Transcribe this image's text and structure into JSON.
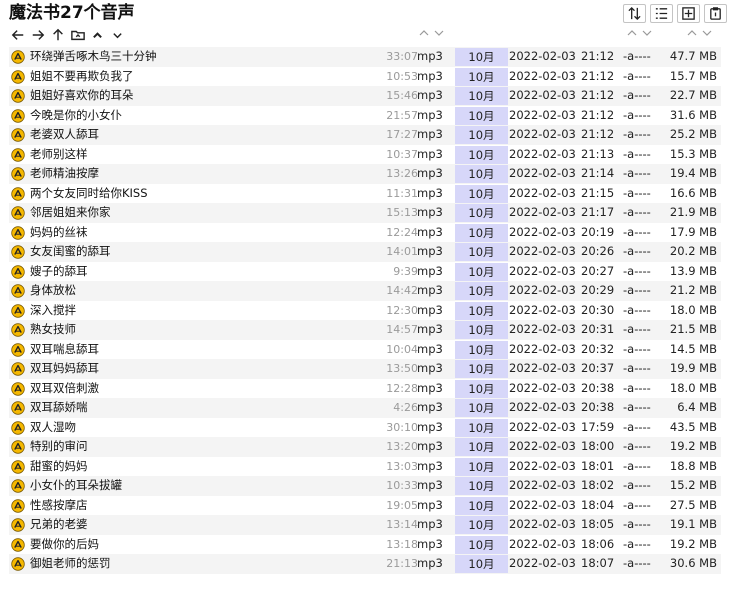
{
  "window": {
    "title": "魔法书27个音声"
  },
  "toolbar": {
    "icons": [
      "sort-icon",
      "checklist-icon",
      "add-box-icon",
      "paste-icon"
    ]
  },
  "nav": {
    "icons": [
      "back-arrow-icon",
      "forward-arrow-icon",
      "up-arrow-icon",
      "folder-up-icon",
      "collapse-up-icon",
      "expand-down-icon"
    ]
  },
  "columns": [
    "name",
    "duration",
    "ext",
    "month",
    "date",
    "time",
    "attributes",
    "size"
  ],
  "files": [
    {
      "name": "环绕弹舌啄木鸟三十分钟",
      "duration": "33:07",
      "ext": "mp3",
      "month": "10月",
      "date": "2022-02-03",
      "time": "21:12",
      "attr": "-a----",
      "size": "47.7 MB"
    },
    {
      "name": "姐姐不要再欺负我了",
      "duration": "10:53",
      "ext": "mp3",
      "month": "10月",
      "date": "2022-02-03",
      "time": "21:12",
      "attr": "-a----",
      "size": "15.7 MB"
    },
    {
      "name": "姐姐好喜欢你的耳朵",
      "duration": "15:46",
      "ext": "mp3",
      "month": "10月",
      "date": "2022-02-03",
      "time": "21:12",
      "attr": "-a----",
      "size": "22.7 MB"
    },
    {
      "name": "今晚是你的小女仆",
      "duration": "21:57",
      "ext": "mp3",
      "month": "10月",
      "date": "2022-02-03",
      "time": "21:12",
      "attr": "-a----",
      "size": "31.6 MB"
    },
    {
      "name": "老婆双人舔耳",
      "duration": "17:27",
      "ext": "mp3",
      "month": "10月",
      "date": "2022-02-03",
      "time": "21:12",
      "attr": "-a----",
      "size": "25.2 MB"
    },
    {
      "name": "老师别这样",
      "duration": "10:37",
      "ext": "mp3",
      "month": "10月",
      "date": "2022-02-03",
      "time": "21:13",
      "attr": "-a----",
      "size": "15.3 MB"
    },
    {
      "name": "老师精油按摩",
      "duration": "13:26",
      "ext": "mp3",
      "month": "10月",
      "date": "2022-02-03",
      "time": "21:14",
      "attr": "-a----",
      "size": "19.4 MB"
    },
    {
      "name": "两个女友同时给你KISS",
      "duration": "11:31",
      "ext": "mp3",
      "month": "10月",
      "date": "2022-02-03",
      "time": "21:15",
      "attr": "-a----",
      "size": "16.6 MB"
    },
    {
      "name": "邻居姐姐来你家",
      "duration": "15:13",
      "ext": "mp3",
      "month": "10月",
      "date": "2022-02-03",
      "time": "21:17",
      "attr": "-a----",
      "size": "21.9 MB"
    },
    {
      "name": "妈妈的丝袜",
      "duration": "12:24",
      "ext": "mp3",
      "month": "10月",
      "date": "2022-02-03",
      "time": "20:19",
      "attr": "-a----",
      "size": "17.9 MB"
    },
    {
      "name": "女友闺蜜的舔耳",
      "duration": "14:01",
      "ext": "mp3",
      "month": "10月",
      "date": "2022-02-03",
      "time": "20:26",
      "attr": "-a----",
      "size": "20.2 MB"
    },
    {
      "name": "嫂子的舔耳",
      "duration": "9:39",
      "ext": "mp3",
      "month": "10月",
      "date": "2022-02-03",
      "time": "20:27",
      "attr": "-a----",
      "size": "13.9 MB"
    },
    {
      "name": "身体放松",
      "duration": "14:42",
      "ext": "mp3",
      "month": "10月",
      "date": "2022-02-03",
      "time": "20:29",
      "attr": "-a----",
      "size": "21.2 MB"
    },
    {
      "name": "深入搅拌",
      "duration": "12:30",
      "ext": "mp3",
      "month": "10月",
      "date": "2022-02-03",
      "time": "20:30",
      "attr": "-a----",
      "size": "18.0 MB"
    },
    {
      "name": "熟女技师",
      "duration": "14:57",
      "ext": "mp3",
      "month": "10月",
      "date": "2022-02-03",
      "time": "20:31",
      "attr": "-a----",
      "size": "21.5 MB"
    },
    {
      "name": "双耳喘息舔耳",
      "duration": "10:04",
      "ext": "mp3",
      "month": "10月",
      "date": "2022-02-03",
      "time": "20:32",
      "attr": "-a----",
      "size": "14.5 MB"
    },
    {
      "name": "双耳妈妈舔耳",
      "duration": "13:50",
      "ext": "mp3",
      "month": "10月",
      "date": "2022-02-03",
      "time": "20:37",
      "attr": "-a----",
      "size": "19.9 MB"
    },
    {
      "name": "双耳双倍刺激",
      "duration": "12:28",
      "ext": "mp3",
      "month": "10月",
      "date": "2022-02-03",
      "time": "20:38",
      "attr": "-a----",
      "size": "18.0 MB"
    },
    {
      "name": "双耳舔娇喘",
      "duration": "4:26",
      "ext": "mp3",
      "month": "10月",
      "date": "2022-02-03",
      "time": "20:38",
      "attr": "-a----",
      "size": "6.4 MB"
    },
    {
      "name": "双人湿吻",
      "duration": "30:10",
      "ext": "mp3",
      "month": "10月",
      "date": "2022-02-03",
      "time": "17:59",
      "attr": "-a----",
      "size": "43.5 MB"
    },
    {
      "name": "特别的审问",
      "duration": "13:20",
      "ext": "mp3",
      "month": "10月",
      "date": "2022-02-03",
      "time": "18:00",
      "attr": "-a----",
      "size": "19.2 MB"
    },
    {
      "name": "甜蜜的妈妈",
      "duration": "13:03",
      "ext": "mp3",
      "month": "10月",
      "date": "2022-02-03",
      "time": "18:01",
      "attr": "-a----",
      "size": "18.8 MB"
    },
    {
      "name": "小女仆的耳朵拔罐",
      "duration": "10:33",
      "ext": "mp3",
      "month": "10月",
      "date": "2022-02-03",
      "time": "18:02",
      "attr": "-a----",
      "size": "15.2 MB"
    },
    {
      "name": "性感按摩店",
      "duration": "19:05",
      "ext": "mp3",
      "month": "10月",
      "date": "2022-02-03",
      "time": "18:04",
      "attr": "-a----",
      "size": "27.5 MB"
    },
    {
      "name": "兄弟的老婆",
      "duration": "13:14",
      "ext": "mp3",
      "month": "10月",
      "date": "2022-02-03",
      "time": "18:05",
      "attr": "-a----",
      "size": "19.1 MB"
    },
    {
      "name": "要做你的后妈",
      "duration": "13:18",
      "ext": "mp3",
      "month": "10月",
      "date": "2022-02-03",
      "time": "18:06",
      "attr": "-a----",
      "size": "19.2 MB"
    },
    {
      "name": "御姐老师的惩罚",
      "duration": "21:13",
      "ext": "mp3",
      "month": "10月",
      "date": "2022-02-03",
      "time": "18:07",
      "attr": "-a----",
      "size": "30.6 MB"
    }
  ],
  "colors": {
    "month_highlight": "#d7d7f9",
    "row_alt": "#f4f4f4",
    "icon_fill": "#f5b800",
    "duration_text": "#9a9a9a"
  }
}
